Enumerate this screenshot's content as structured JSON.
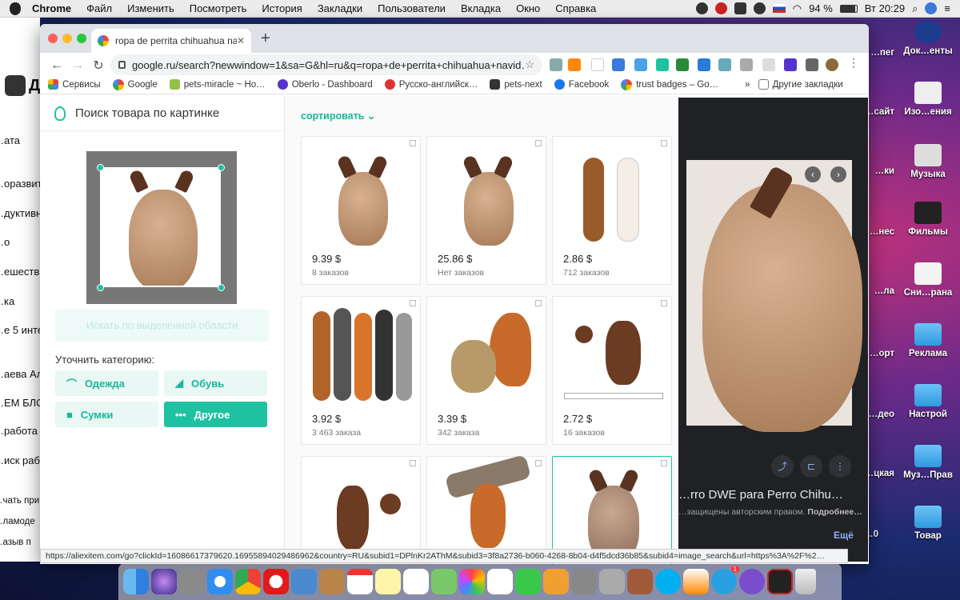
{
  "menubar": {
    "items": [
      "Chrome",
      "Файл",
      "Изменить",
      "Посмотреть",
      "История",
      "Закладки",
      "Пользователи",
      "Вкладка",
      "Окно",
      "Справка"
    ],
    "battery": "94 %",
    "clock": "Вт 20:29"
  },
  "desktop": {
    "icons": [
      "Док…енты",
      "…пег",
      "Изо…ения",
      "…сайт",
      "Музыка",
      "…ки",
      "Фильмы",
      "…нес",
      "Сни…рана",
      "…ла",
      "Реклама",
      "…орт",
      "Настрой",
      "…део",
      "Муз…Прав",
      "…цкая",
      "Товар",
      "…0"
    ]
  },
  "left_app": {
    "header": "Д",
    "rows": [
      "…ата",
      "…оразвит",
      "…дуктивн",
      "…о",
      "…ешестви",
      "…ка",
      "…е 5 инте",
      "…аева Але",
      "…ЕМ БЛО",
      "…работа",
      "…иск рабо",
      "…чать при",
      "…ламоде",
      "…азыв п"
    ]
  },
  "browser": {
    "tab_title": "ropa de perrita chihuahua navi…",
    "new_tab": "+",
    "url": "google.ru/search?newwindow=1&sa=G&hl=ru&q=ropa+de+perrita+chihuahua+navid…",
    "bookmarks": [
      {
        "label": "Сервисы",
        "icon": "apps-grid-icon"
      },
      {
        "label": "Google",
        "icon": "google-icon"
      },
      {
        "label": "pets-miracle ~ Ho…",
        "icon": "shopify-icon"
      },
      {
        "label": "Oberlo - Dashboard",
        "icon": "oberlo-icon"
      },
      {
        "label": "Русско-английск…",
        "icon": "dictionary-icon"
      },
      {
        "label": "pets-next",
        "icon": "pets-next-icon"
      },
      {
        "label": "Facebook",
        "icon": "facebook-icon"
      },
      {
        "label": "trust badges – Go…",
        "icon": "google-icon"
      }
    ],
    "bookmarks_more": "»",
    "other_bookmarks": "Другие закладки",
    "status_url": "https://aliexitem.com/go?clickId=16086617379620.16955894029486962&country=RU&subid1=DPlnKr2AThM&subid3=3f8a2736-b060-4268-8b04-d4f5dcd36b85&subid4=image_search&url=https%3A%2F%2…"
  },
  "panel": {
    "title": "Поиск товара по картинке",
    "search_selected": "Искать по выделенной области",
    "refine_label": "Уточнить категорию:",
    "categories": [
      {
        "label": "Одежда",
        "icon": "hanger-icon",
        "active": false
      },
      {
        "label": "Обувь",
        "icon": "shoe-icon",
        "active": false
      },
      {
        "label": "Сумки",
        "icon": "bag-icon",
        "active": false
      },
      {
        "label": "Другое",
        "icon": "more-icon",
        "active": true
      }
    ]
  },
  "results": {
    "sort_label": "сортировать ⌄",
    "items": [
      {
        "price": "9.39 $",
        "orders": "8 заказов"
      },
      {
        "price": "25.86 $",
        "orders": "Нет заказов"
      },
      {
        "price": "2.86 $",
        "orders": "712 заказов"
      },
      {
        "price": "3.92 $",
        "orders": "3 463 заказа"
      },
      {
        "price": "3.39 $",
        "orders": "342 заказа"
      },
      {
        "price": "2.72 $",
        "orders": "16 заказов"
      },
      {
        "price": "",
        "orders": ""
      },
      {
        "price": "",
        "orders": ""
      },
      {
        "price": "",
        "orders": ""
      }
    ]
  },
  "google_panel": {
    "title": "…rro DWE para Perro Chihu…",
    "sub": "…защищены авторским правом.",
    "more": "Подробнее…",
    "link": "Ещё"
  },
  "colors": {
    "accent": "#1ec2a0",
    "dark_panel": "#202124"
  }
}
